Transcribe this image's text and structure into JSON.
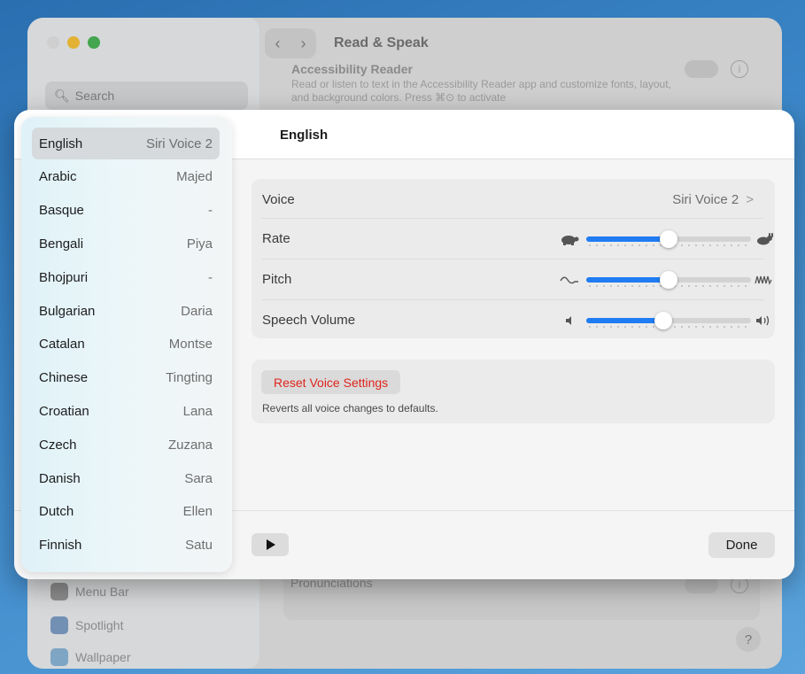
{
  "background_window": {
    "search_placeholder": "Search",
    "title": "Read & Speak",
    "accessibility_reader_title": "Accessibility Reader",
    "accessibility_reader_desc": "Read or listen to text in the Accessibility Reader app and customize fonts, layout, and background colors. Press ⌘⊙ to activate",
    "pronunciations_label": "Pronunciations",
    "help_label": "?",
    "sidebar_items": [
      "Menu Bar",
      "Spotlight",
      "Wallpaper"
    ],
    "info_label": "i"
  },
  "sheet": {
    "title": "English",
    "languages": [
      {
        "name": "English",
        "voice": "Siri Voice 2",
        "selected": true
      },
      {
        "name": "Arabic",
        "voice": "Majed"
      },
      {
        "name": "Basque",
        "voice": "-"
      },
      {
        "name": "Bengali",
        "voice": "Piya"
      },
      {
        "name": "Bhojpuri",
        "voice": "-"
      },
      {
        "name": "Bulgarian",
        "voice": "Daria"
      },
      {
        "name": "Catalan",
        "voice": "Montse"
      },
      {
        "name": "Chinese",
        "voice": "Tingting"
      },
      {
        "name": "Croatian",
        "voice": "Lana"
      },
      {
        "name": "Czech",
        "voice": "Zuzana"
      },
      {
        "name": "Danish",
        "voice": "Sara"
      },
      {
        "name": "Dutch",
        "voice": "Ellen"
      },
      {
        "name": "Finnish",
        "voice": "Satu"
      }
    ],
    "settings": {
      "voice_label": "Voice",
      "voice_value": "Siri Voice 2",
      "chevron": ">",
      "rate_label": "Rate",
      "rate_value": 0.5,
      "pitch_label": "Pitch",
      "pitch_value": 0.5,
      "volume_label": "Speech Volume",
      "volume_value": 0.47
    },
    "reset_button_label": "Reset Voice Settings",
    "reset_description": "Reverts all voice changes to defaults.",
    "done_button_label": "Done"
  },
  "colors": {
    "accent": "#1f7cf3",
    "reset_red": "#e0241c",
    "traffic_yellow": "#e8b227",
    "traffic_green": "#3ba846"
  },
  "icons": {
    "rate_low": "turtle-icon",
    "rate_high": "rabbit-icon",
    "pitch_low": "low-wave-icon",
    "pitch_high": "high-wave-icon",
    "volume_low": "speaker-low-icon",
    "volume_high": "speaker-high-icon"
  }
}
